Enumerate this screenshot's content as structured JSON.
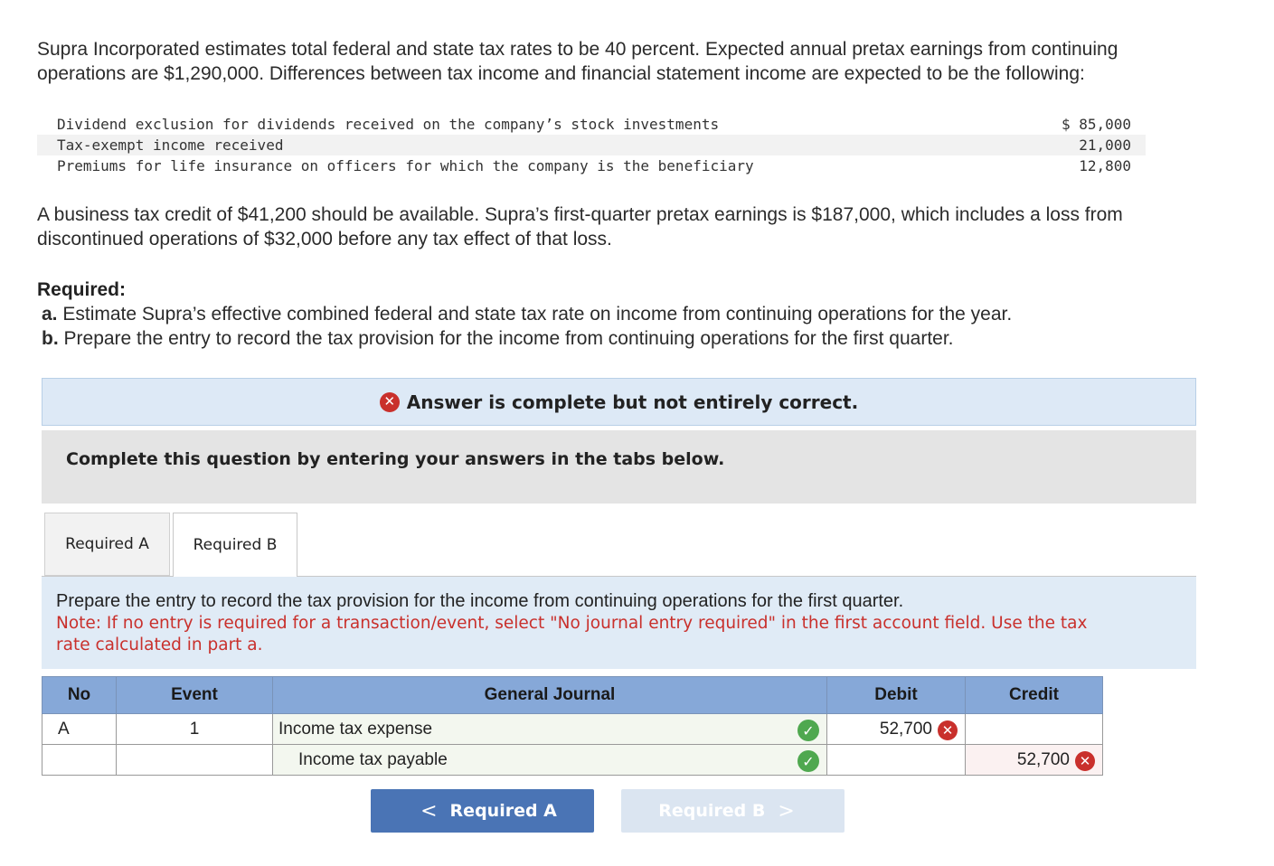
{
  "intro": {
    "line1": "Supra Incorporated estimates total federal and state tax rates to be 40 percent. Expected annual pretax earnings from continuing",
    "line2": "operations are $1,290,000. Differences between tax income and financial statement income are expected to be the following:"
  },
  "differences": [
    {
      "label": "Dividend exclusion for dividends received on the company’s stock investments",
      "amount": "$ 85,000"
    },
    {
      "label": "Tax-exempt income received",
      "amount": "21,000"
    },
    {
      "label": "Premiums for life insurance on officers for which the company is the beneficiary",
      "amount": "12,800"
    }
  ],
  "credit_para": {
    "line1": "A business tax credit of $41,200 should be available. Supra’s first-quarter pretax earnings is $187,000, which includes a loss from",
    "line2": "discontinued operations of $32,000 before any tax effect of that loss."
  },
  "required": {
    "heading": "Required:",
    "a_label": "a.",
    "a_text": "Estimate Supra’s effective combined federal and state tax rate on income from continuing operations for the year.",
    "b_label": "b.",
    "b_text": "Prepare the entry to record the tax provision for the income from continuing operations for the first quarter."
  },
  "banner": {
    "text": "Answer is complete but not entirely correct."
  },
  "instruction_box": {
    "text": "Complete this question by entering your answers in the tabs below."
  },
  "tabs": [
    {
      "label": "Required A",
      "active": false
    },
    {
      "label": "Required B",
      "active": true
    }
  ],
  "tab_content": {
    "prompt": "Prepare the entry to record the tax provision for the income from continuing operations for the first quarter.",
    "note_line1": "Note: If no entry is required for a transaction/event, select \"No journal entry required\" in the first account field. Use the tax",
    "note_line2": "rate calculated in part a."
  },
  "journal": {
    "headers": {
      "no": "No",
      "event": "Event",
      "general_journal": "General Journal",
      "debit": "Debit",
      "credit": "Credit"
    },
    "rows": [
      {
        "no": "A",
        "event": "1",
        "account": "Income tax expense",
        "debit": "52,700",
        "credit": ""
      },
      {
        "no": "",
        "event": "",
        "account": "Income tax payable",
        "debit": "",
        "credit": "52,700"
      }
    ]
  },
  "nav": {
    "prev_label": "Required A",
    "next_label": "Required B"
  },
  "icons": {
    "correct": "check-circle-icon",
    "incorrect": "x-circle-icon"
  },
  "colors": {
    "correct": "#4fa84f",
    "incorrect": "#c9302c",
    "header": "#86a8d8",
    "button": "#4a74b5"
  }
}
